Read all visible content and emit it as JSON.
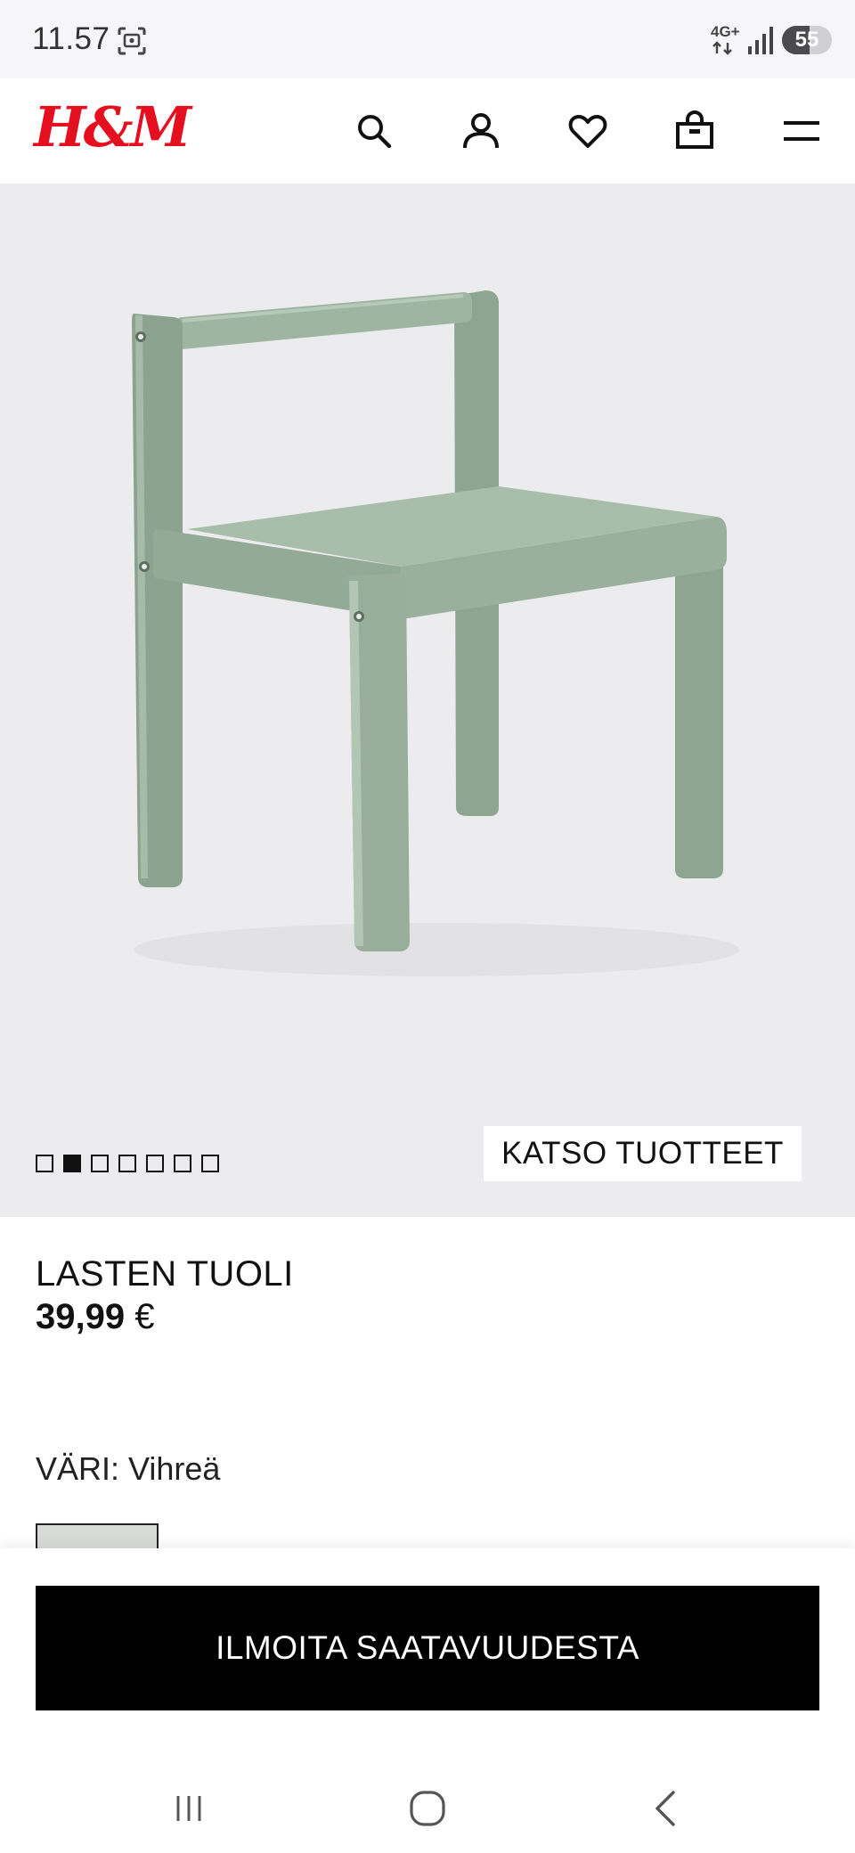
{
  "status_bar": {
    "time": "11.57",
    "network": "4G+",
    "battery": "55",
    "battery_level": 0.55
  },
  "header": {
    "logo": "H&M",
    "icons": [
      "search-icon",
      "account-icon",
      "heart-icon",
      "shopping-bag-icon",
      "menu-icon"
    ]
  },
  "gallery": {
    "total_images": 7,
    "active_index": 1,
    "katso_label": "KATSO TUOTTEET",
    "background_color": "#ececee",
    "chair_color": "#9fb5a2"
  },
  "product": {
    "name": "LASTEN TUOLI",
    "price_value": "39,99",
    "currency": "€",
    "color_label": "VÄRI: Vihreä"
  },
  "cta": {
    "label": "ILMOITA SAATAVUUDESTA",
    "background": "#000000"
  },
  "nav": {
    "icons": [
      "recent-apps-icon",
      "home-icon",
      "back-icon"
    ]
  },
  "colors": {
    "brand_red": "#e4101f"
  }
}
